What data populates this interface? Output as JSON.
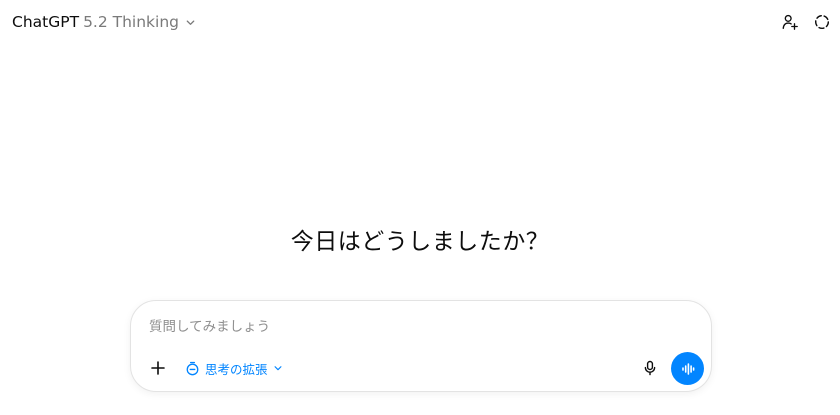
{
  "header": {
    "model_name": "ChatGPT",
    "model_version": "5.2 Thinking",
    "model_chevron_icon": "chevron-down-icon",
    "actions": [
      {
        "icon": "add-person-icon"
      },
      {
        "icon": "temporary-chat-icon"
      }
    ]
  },
  "main": {
    "greeting": "今日はどうしましたか？"
  },
  "composer": {
    "placeholder": "質問してみましょう",
    "value": "",
    "add_icon": "plus-icon",
    "thinking_mode_label": "思考の拡張",
    "thinking_mode_icon": "timer-icon",
    "mic_icon": "microphone-icon",
    "voice_icon": "voice-waveform-icon"
  },
  "colors": {
    "accent": "#0285ff",
    "text": "#0d0d0d",
    "muted": "#7a7a7a",
    "border": "#e3e3e3"
  }
}
